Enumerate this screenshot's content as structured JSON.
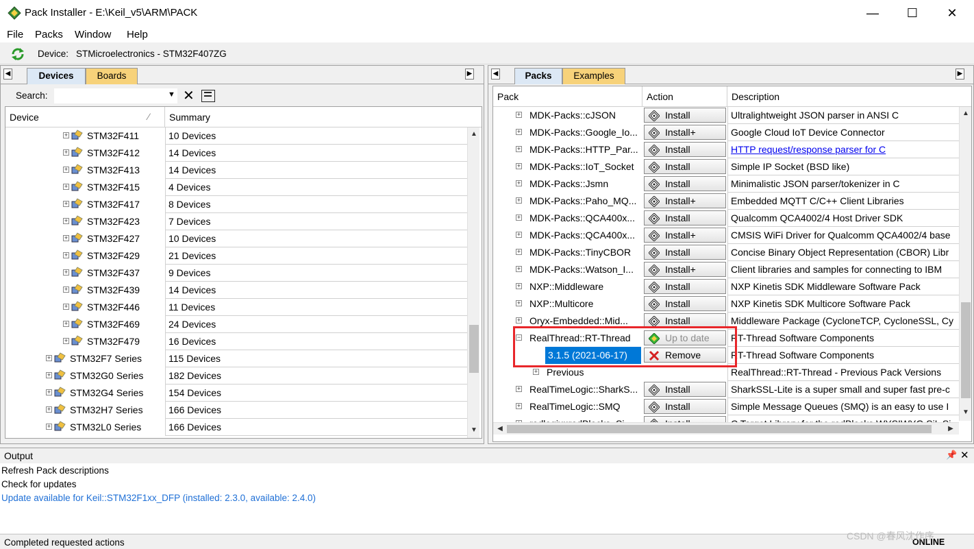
{
  "window": {
    "title": "Pack Installer - E:\\Keil_v5\\ARM\\PACK",
    "minimize": "—",
    "maximize": "☐",
    "close": "✕"
  },
  "menu": [
    "File",
    "Packs",
    "Window",
    "Help"
  ],
  "device_bar": {
    "label": "Device:",
    "value": "STMicroelectronics - STM32F407ZG"
  },
  "left_pane": {
    "tabs": [
      "Devices",
      "Boards"
    ],
    "search_label": "Search:",
    "search_value": "",
    "columns": [
      "Device",
      "Summary"
    ],
    "rows": [
      {
        "name": "STM32F411",
        "summary": "10 Devices",
        "level": 2
      },
      {
        "name": "STM32F412",
        "summary": "14 Devices",
        "level": 2
      },
      {
        "name": "STM32F413",
        "summary": "14 Devices",
        "level": 2
      },
      {
        "name": "STM32F415",
        "summary": "4 Devices",
        "level": 2
      },
      {
        "name": "STM32F417",
        "summary": "8 Devices",
        "level": 2
      },
      {
        "name": "STM32F423",
        "summary": "7 Devices",
        "level": 2
      },
      {
        "name": "STM32F427",
        "summary": "10 Devices",
        "level": 2
      },
      {
        "name": "STM32F429",
        "summary": "21 Devices",
        "level": 2
      },
      {
        "name": "STM32F437",
        "summary": "9 Devices",
        "level": 2
      },
      {
        "name": "STM32F439",
        "summary": "14 Devices",
        "level": 2
      },
      {
        "name": "STM32F446",
        "summary": "11 Devices",
        "level": 2
      },
      {
        "name": "STM32F469",
        "summary": "24 Devices",
        "level": 2
      },
      {
        "name": "STM32F479",
        "summary": "16 Devices",
        "level": 2
      },
      {
        "name": "STM32F7 Series",
        "summary": "115 Devices",
        "level": 1
      },
      {
        "name": "STM32G0 Series",
        "summary": "182 Devices",
        "level": 1
      },
      {
        "name": "STM32G4 Series",
        "summary": "154 Devices",
        "level": 1
      },
      {
        "name": "STM32H7 Series",
        "summary": "166 Devices",
        "level": 1
      },
      {
        "name": "STM32L0 Series",
        "summary": "166 Devices",
        "level": 1
      }
    ]
  },
  "right_pane": {
    "tabs": [
      "Packs",
      "Examples"
    ],
    "columns": [
      "Pack",
      "Action",
      "Description"
    ],
    "rows": [
      {
        "pack": "MDK-Packs::cJSON",
        "action": "Install",
        "desc": "Ultralightweight JSON parser in ANSI C"
      },
      {
        "pack": "MDK-Packs::Google_Io...",
        "action": "Install+",
        "desc": "Google Cloud IoT Device Connector"
      },
      {
        "pack": "MDK-Packs::HTTP_Par...",
        "action": "Install",
        "desc": "HTTP request/response parser for C",
        "link": true
      },
      {
        "pack": "MDK-Packs::IoT_Socket",
        "action": "Install",
        "desc": "Simple IP Socket (BSD like)"
      },
      {
        "pack": "MDK-Packs::Jsmn",
        "action": "Install",
        "desc": "Minimalistic JSON parser/tokenizer in C"
      },
      {
        "pack": "MDK-Packs::Paho_MQ...",
        "action": "Install+",
        "desc": "Embedded MQTT C/C++ Client Libraries"
      },
      {
        "pack": "MDK-Packs::QCA400x...",
        "action": "Install",
        "desc": "Qualcomm QCA4002/4 Host Driver SDK"
      },
      {
        "pack": "MDK-Packs::QCA400x...",
        "action": "Install+",
        "desc": "CMSIS WiFi Driver for Qualcomm QCA4002/4 base"
      },
      {
        "pack": "MDK-Packs::TinyCBOR",
        "action": "Install",
        "desc": "Concise Binary Object Representation (CBOR) Libr"
      },
      {
        "pack": "MDK-Packs::Watson_I...",
        "action": "Install+",
        "desc": "Client libraries and samples for connecting to IBM"
      },
      {
        "pack": "NXP::Middleware",
        "action": "Install",
        "desc": "NXP Kinetis SDK Middleware Software Pack"
      },
      {
        "pack": "NXP::Multicore",
        "action": "Install",
        "desc": "NXP Kinetis SDK Multicore Software Pack"
      },
      {
        "pack": "Oryx-Embedded::Mid...",
        "action": "Install",
        "desc": "Middleware Package (CycloneTCP, CycloneSSL, Cy"
      },
      {
        "pack": "RealThread::RT-Thread",
        "action": "Up to date",
        "desc": "RT-Thread Software Components",
        "expanded": true,
        "state": "uptodate"
      },
      {
        "pack": "3.1.5 (2021-06-17)",
        "action": "Remove",
        "desc": "RT-Thread Software Components",
        "child": true,
        "state": "remove"
      },
      {
        "pack": "Previous",
        "action": "",
        "desc": "RealThread::RT-Thread - Previous Pack Versions",
        "child": true,
        "state": "previous"
      },
      {
        "pack": "RealTimeLogic::SharkS...",
        "action": "Install",
        "desc": "SharkSSL-Lite is a super small and super fast pre-c"
      },
      {
        "pack": "RealTimeLogic::SMQ",
        "action": "Install",
        "desc": "Simple Message Queues (SMQ) is an easy to use I"
      },
      {
        "pack": "redlogix::redBlocks_Si...",
        "action": "Install",
        "desc": "C Target Library for the redBlocks WYSIWYG SiL Si"
      }
    ]
  },
  "output": {
    "title": "Output",
    "lines": [
      {
        "text": "Refresh Pack descriptions",
        "color": "#000000"
      },
      {
        "text": "Check for updates",
        "color": "#000000"
      },
      {
        "text": "Update available for Keil::STM32F1xx_DFP (installed: 2.3.0,  available: 2.4.0)",
        "color": "#1e6fd6"
      }
    ]
  },
  "status": {
    "text": "Completed requested actions",
    "mode": "ONLINE"
  },
  "watermark": "CSDN @春风沈作序",
  "colors": {
    "highlight": "#e8262a",
    "selection": "#0078d7",
    "tab_active": "#dce8f5",
    "tab_inactive": "#f7d27a"
  }
}
